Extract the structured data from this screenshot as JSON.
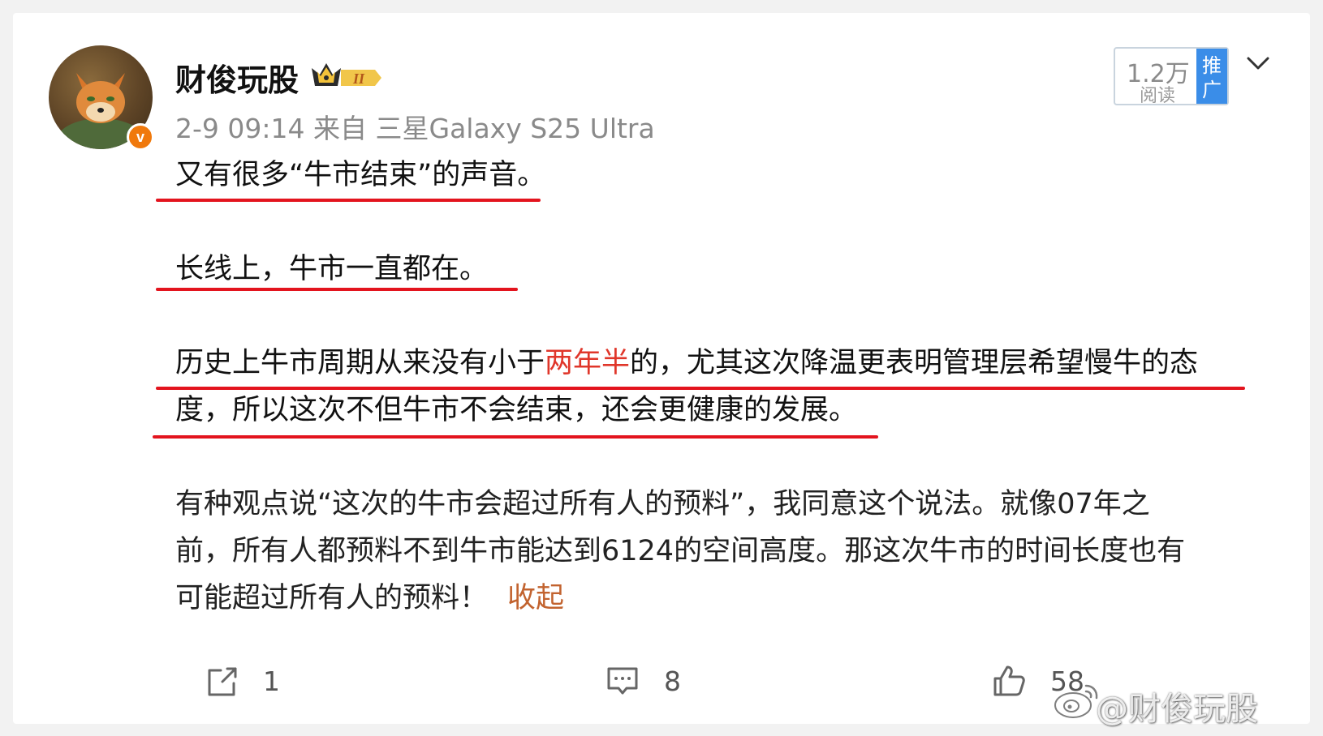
{
  "post": {
    "username": "财俊玩股",
    "level_badge": "II",
    "timestamp": "2-9 09:14",
    "source_prefix": "来自",
    "device": "三星Galaxy S25 Ultra",
    "paragraphs": {
      "p1": "又有很多“牛市结束”的声音。",
      "p2": "长线上，牛市一直都在。",
      "p3_line1_before": "历史上牛市周期从来没有小于",
      "p3_line1_highlight": "两年半",
      "p3_line1_after": "的，尤其这次降温更表明管理层希望慢牛的态",
      "p3_line2": "度，所以这次不但牛市不会结束，还会更健康的发展。",
      "p4_line1": "有种观点说“这次的牛市会超过所有人的预料”，我同意这个说法。就像07年之",
      "p4_line2": "前，所有人都预料不到牛市能达到6124的空间高度。那这次牛市的时间长度也有",
      "p4_line3": "可能超过所有人的预料！"
    },
    "collapse_label": "收起"
  },
  "stats": {
    "read_count": "1.2万",
    "read_label": "阅读",
    "promo_label_1": "推",
    "promo_label_2": "广"
  },
  "actions": {
    "repost_count": "1",
    "comment_count": "8",
    "like_count": "58"
  },
  "watermark": "@财俊玩股",
  "colors": {
    "underline": "#e3141e",
    "highlight_text": "#e0362a",
    "collapse_link": "#c2632f",
    "promo_bg": "#3a8de8",
    "verified_badge": "#f0790c"
  },
  "icons": [
    "repost-icon",
    "comment-icon",
    "like-icon",
    "chevron-down-icon",
    "verified-icon",
    "crown-icon"
  ]
}
